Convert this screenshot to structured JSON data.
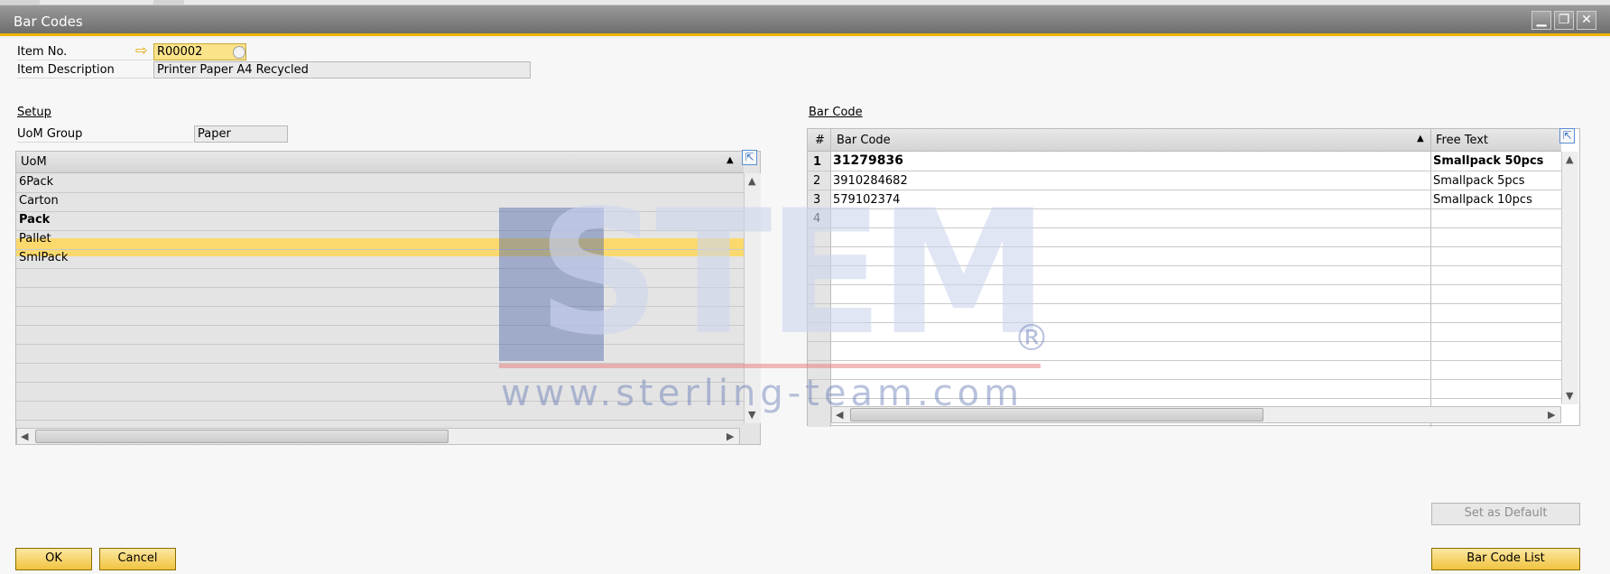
{
  "window": {
    "title": "Bar Codes",
    "minimize": "▁",
    "restore": "❐",
    "close": "✕"
  },
  "header": {
    "item_no_label": "Item No.",
    "item_no_value": "R00002",
    "item_desc_label": "Item Description",
    "item_desc_value": "Printer Paper A4 Recycled"
  },
  "setup": {
    "section_label": "Setup",
    "uom_group_label": "UoM Group",
    "uom_group_value": "Paper",
    "uom_column": "UoM",
    "uom_items": [
      "6Pack",
      "Carton",
      "Pack",
      "Pallet",
      "SmlPack"
    ],
    "selected_index": 4,
    "bold_index": 2
  },
  "barcode": {
    "section_label": "Bar Code",
    "columns": {
      "num": "#",
      "bar_code": "Bar Code",
      "free_text": "Free Text"
    },
    "rows": [
      {
        "num": "1",
        "bar_code": "31279836",
        "free_text": "Smallpack 50pcs"
      },
      {
        "num": "2",
        "bar_code": "3910284682",
        "free_text": "Smallpack 5pcs"
      },
      {
        "num": "3",
        "bar_code": "579102374",
        "free_text": "Smallpack 10pcs"
      },
      {
        "num": "4",
        "bar_code": "",
        "free_text": ""
      }
    ]
  },
  "buttons": {
    "ok": "OK",
    "cancel": "Cancel",
    "set_default": "Set as Default",
    "bar_code_list": "Bar Code List"
  },
  "watermark": {
    "text": "STEM",
    "url": "www.sterling-team.com",
    "mark": "®"
  },
  "icons": {
    "arrow": "arrow-right-icon",
    "lookup": "lookup-icon",
    "expand": "expand-grid-icon",
    "sort": "sort-ascending-icon"
  }
}
